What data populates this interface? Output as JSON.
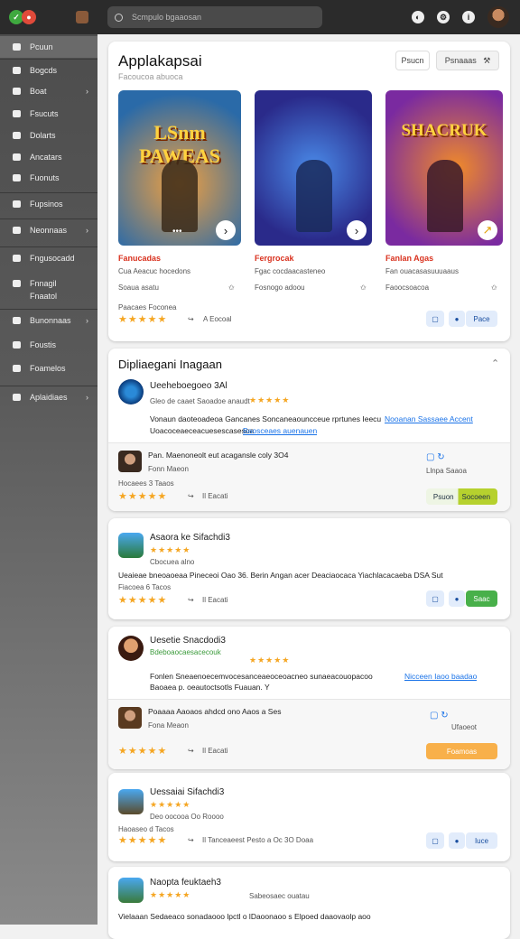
{
  "topbar": {
    "search_placeholder": "Scmpulo bgaaosan"
  },
  "sidebar": {
    "items": [
      {
        "label": "Pcuun",
        "chev": ""
      },
      {
        "label": "Bogcds",
        "chev": ""
      },
      {
        "label": "Boat",
        "chev": "›"
      },
      {
        "label": "Fsucuts",
        "chev": ""
      },
      {
        "label": "Dolarts",
        "chev": ""
      },
      {
        "label": "Ancatars",
        "chev": ""
      },
      {
        "label": "Fuonuts",
        "chev": ""
      },
      {
        "label": "Fupsinos",
        "chev": ""
      },
      {
        "label": "Neonnaas",
        "chev": "›"
      },
      {
        "label": "Fngusocadd",
        "chev": ""
      },
      {
        "label": "Fnnagil",
        "chev": ""
      },
      {
        "label": "Fnaatol",
        "chev": ""
      },
      {
        "label": "Bunonnaas",
        "chev": "›"
      },
      {
        "label": "Foustis",
        "chev": ""
      },
      {
        "label": "Foamelos",
        "chev": ""
      },
      {
        "label": "Aplaidiaes",
        "chev": "›"
      }
    ]
  },
  "hero": {
    "title": "Applakapsai",
    "subtitle": "Facoucoa abuoca",
    "btn1": "Psucn",
    "btn2": "Psnaaas",
    "games": [
      {
        "art": "LSnm PAWEAS",
        "name": "Fanucadas",
        "meta1": "Cua Aeacuc hocedons",
        "meta2": "Soaua asatu",
        "color1": "#e68b2a",
        "color2": "#2a6aa8"
      },
      {
        "art": "",
        "name": "Fergrocak",
        "meta1": "Fgac cocdaacasteneo",
        "meta2": "Fosnogo adoou",
        "color1": "#2a4a9a",
        "color2": "#7a3ab0"
      },
      {
        "art": "SHACRUK",
        "name": "Fanlan Agas",
        "meta1": "Fan ouacasasuuuaaus",
        "meta2": "Faoocsoacoa",
        "color1": "#c43a8a",
        "color2": "#f08a2a"
      }
    ],
    "rating_label": "Paacaes Foconea",
    "stars": "★★★★★",
    "footer": "A Eocoal",
    "chip": "Pace"
  },
  "section": {
    "title": "Dipliaegani Inagaan",
    "chev": "⌃"
  },
  "reviews": [
    {
      "name": "Ueeheboegoeo 3Al",
      "meta": "Gleo de caaet  Saoadoe anaudt",
      "stars": "★★★★★",
      "text": "Vonaun daoteoadeoa Gancanes Soncaneaouncceue rprtunes Ieecu",
      "link": "Nooanan Sassaee Accent",
      "text2": "Uoacoceaeceacuesescasesoa",
      "link2": "Baosceaes auenauen"
    },
    {
      "name": "Pan. Maenoneolt eut acagansle coly 3O4",
      "meta": "Fonn Maeon",
      "rate": "Hocaees 3 Taaos",
      "stars": "★★★★★",
      "footer": "Il Eacati",
      "chipA": "Psuon",
      "chipB": "Socoeen",
      "right": "Llnpa  Saaoa"
    },
    {
      "name": "Asaora ke Sifachdi3",
      "meta": "Cbocuea alno",
      "stars": "★★★★★",
      "text": "Ueaieae bneoaoeaa Pineceoi Oao 36. Berin Angan acer Deaciaocaca Yiachlacacaeba DSA Sut",
      "rate": "Fiacoea 6 Tacos",
      "footer": "Il Eacati",
      "chip": "Saac"
    },
    {
      "name": "Uesetie Snacdodi3",
      "meta": "Bdeboaocaesacecouk",
      "stars": "★★★★★",
      "text": "Fonlen Sneaenoecemvocesanceaeoceoacneo sunaeacouopacoo",
      "link": "Nicceen Iaoo baadao",
      "text2": "Baoaea p. oeautoctsotls Fuauan. Y"
    },
    {
      "name": "Poaaaa Aaoaos ahdcd ono Aaos a Ses",
      "meta": "Fona Meaon",
      "stars": "★★★★★",
      "footer": "Il Eacati",
      "chip": "Foamoas",
      "right": "Ufaoeot"
    },
    {
      "name": "Uessaiai Sifachdi3",
      "meta": "Deo oocooa Oo Roooo",
      "rate": "Haoaseo d Tacos",
      "stars": "★★★★★",
      "footer": "Il Tanceaeest Pesto a Oc 3O Doaa",
      "chip": "Iuce"
    },
    {
      "name": "Naopta feuktaeh3",
      "meta": "Sabeosaec ouatau",
      "stars": "★★★★★",
      "text": "Vielaaan Sedaeaco sonadaooo lpctl o lDaoonaoo s Elpoed daaovaolp aoo"
    }
  ]
}
